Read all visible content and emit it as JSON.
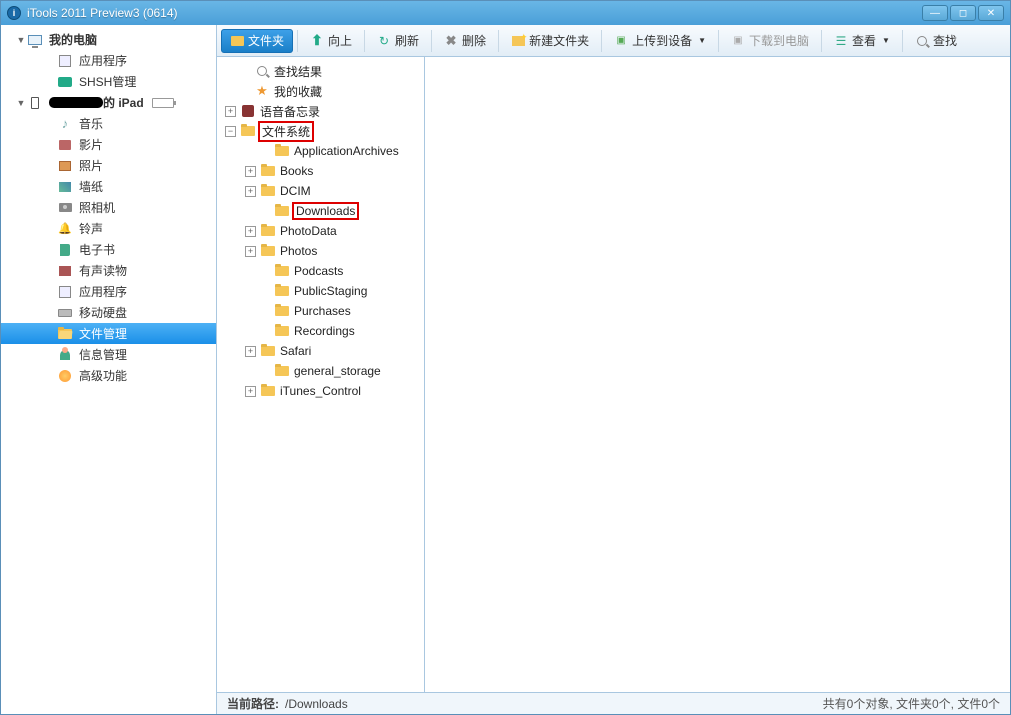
{
  "title": "iTools 2011 Preview3 (0614)",
  "sidebar": {
    "root1": "我的电脑",
    "root1_items": [
      "应用程序",
      "SHSH管理"
    ],
    "root2_suffix": " 的 iPad",
    "root2_items": [
      "音乐",
      "影片",
      "照片",
      "墙纸",
      "照相机",
      "铃声",
      "电子书",
      "有声读物",
      "应用程序",
      "移动硬盘",
      "文件管理",
      "信息管理",
      "高级功能"
    ]
  },
  "toolbar": {
    "folders": "文件夹",
    "up": "向上",
    "refresh": "刷新",
    "delete": "删除",
    "newfolder": "新建文件夹",
    "upload": "上传到设备",
    "download": "下载到电脑",
    "view": "查看",
    "find": "查找"
  },
  "tree": {
    "search_results": "查找结果",
    "favorites": "我的收藏",
    "voice_memos": "语音备忘录",
    "file_system": "文件系统",
    "folders": [
      "ApplicationArchives",
      "Books",
      "DCIM",
      "Downloads",
      "PhotoData",
      "Photos",
      "Podcasts",
      "PublicStaging",
      "Purchases",
      "Recordings",
      "Safari",
      "general_storage",
      "iTunes_Control"
    ]
  },
  "status": {
    "path_label": "当前路径:",
    "path_value": "/Downloads",
    "summary": "共有0个对象, 文件夹0个, 文件0个"
  }
}
